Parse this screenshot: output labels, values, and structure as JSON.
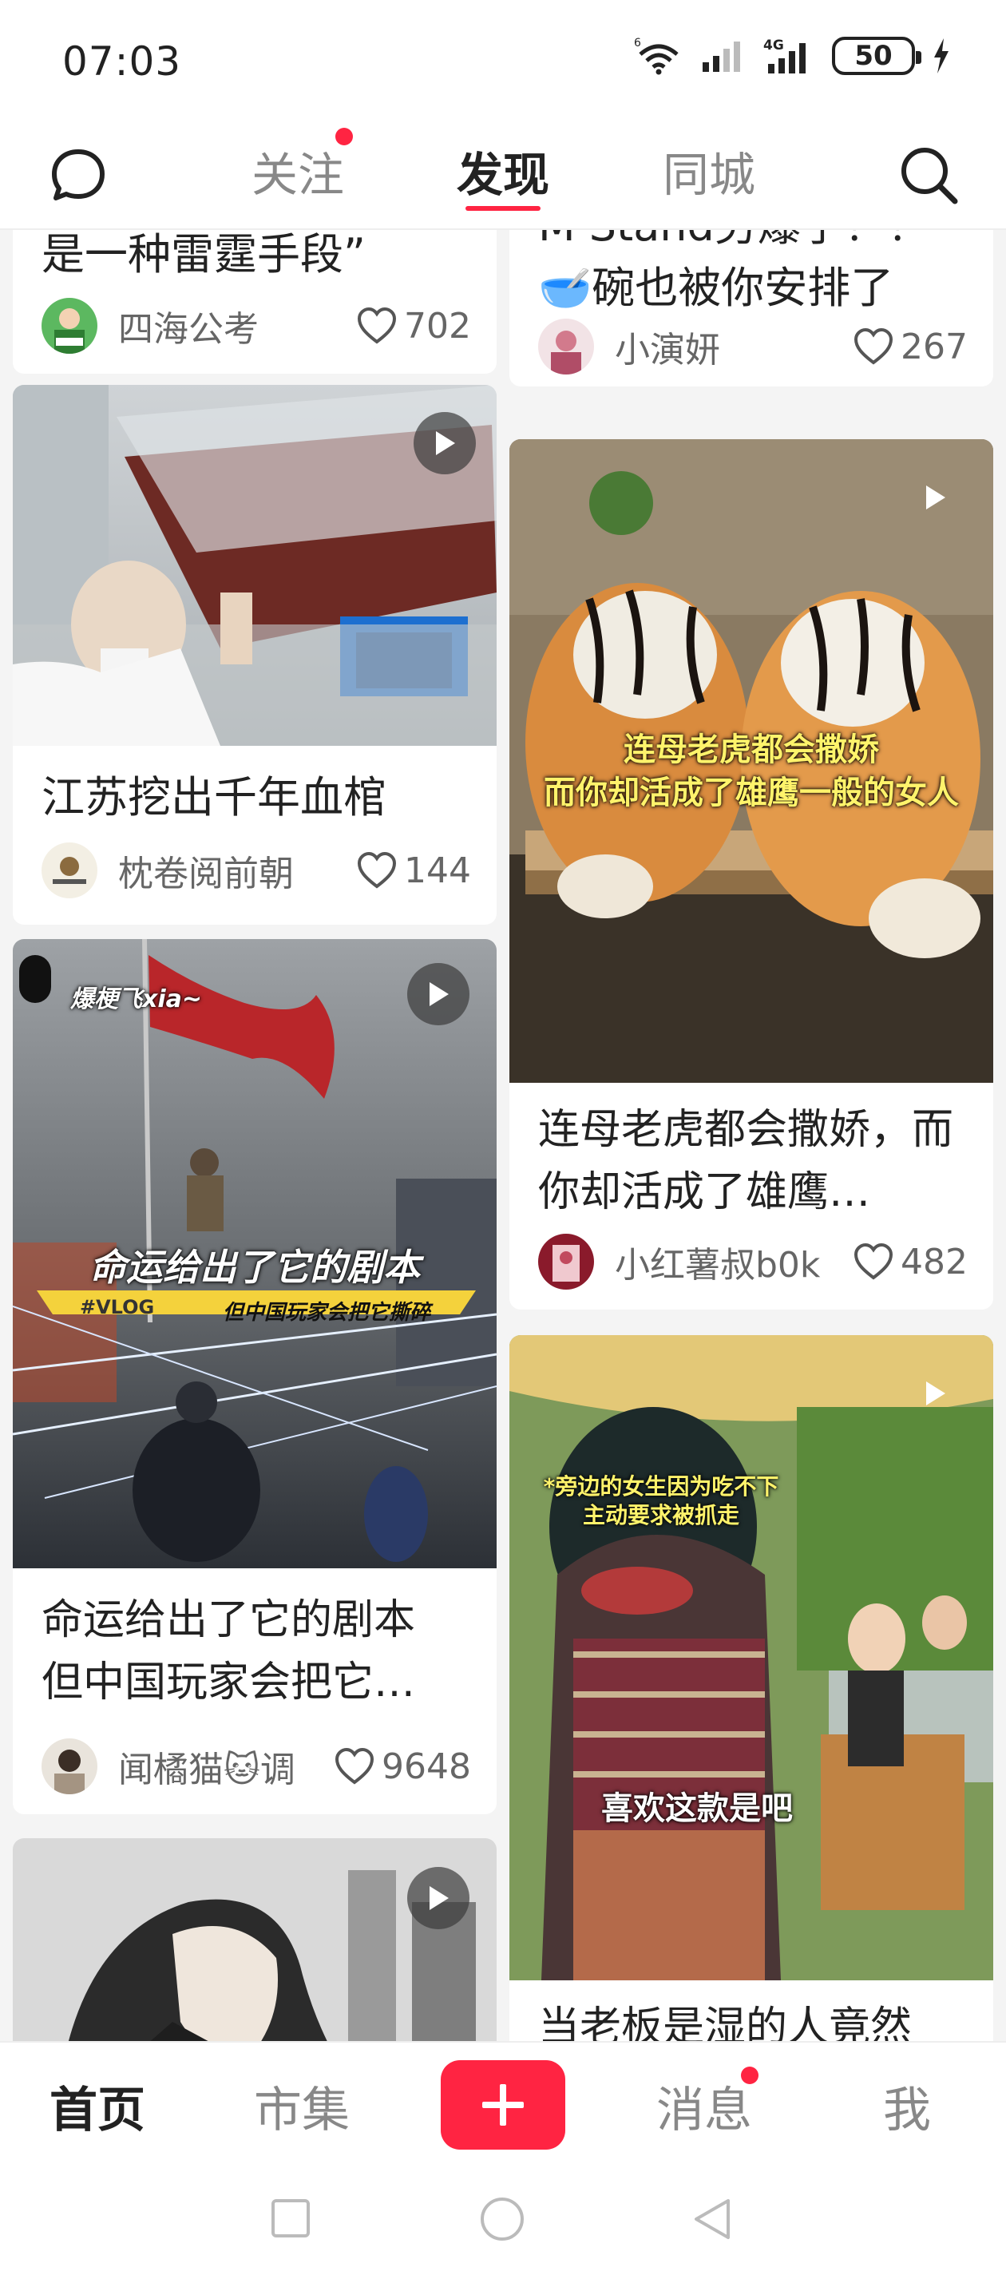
{
  "status_bar": {
    "time": "07:03",
    "battery": "50",
    "network": "4G",
    "wifi_badge": "6"
  },
  "top_nav": {
    "message_icon": "chat-bubble-icon",
    "tabs": [
      "关注",
      "发现",
      "同城"
    ],
    "active_tab": "发现",
    "search_icon": "search-icon"
  },
  "feed": {
    "cards": [
      {
        "title": "是一种雷霆手段”",
        "author": "四海公考",
        "likes": "702"
      },
      {
        "title": "江苏挖出千年血棺",
        "author": "枕卷阅前朝",
        "likes": "144"
      },
      {
        "title": "命运给出了它的剧本 但中国玩家会把它…",
        "author": "闻橘猫🐱调",
        "likes": "9648",
        "overlay_line1": "命运给出了它的剧本",
        "overlay_line2": "但中国玩家会把它撕碎",
        "overlay_tag": "#VLOG",
        "overlay_user": "爆梗飞xia~"
      },
      {
        "title": "M Stand劳爆了！！ 🥣碗也被你安排了",
        "author": "小演妍",
        "likes": "267"
      },
      {
        "title": "连母老虎都会撒娇，而你却活成了雄鹰…",
        "author": "小红薯叔b0k",
        "likes": "482",
        "overlay_line1": "连母老虎都会撒娇",
        "overlay_line2": "而你却活成了雄鹰一般的女人"
      },
      {
        "title": "当老板是湿的人竟然",
        "overlay_line1": "*旁边的女生因为吃不下",
        "overlay_line2": "主动要求被抓走",
        "overlay_line3": "喜欢这款是吧"
      }
    ]
  },
  "bottom_nav": {
    "items": [
      "首页",
      "市集",
      "消息",
      "我"
    ],
    "active": "首页",
    "plus_icon": "plus-icon"
  },
  "system_nav": {
    "icons": [
      "recents-square-icon",
      "home-circle-icon",
      "back-triangle-icon"
    ]
  }
}
